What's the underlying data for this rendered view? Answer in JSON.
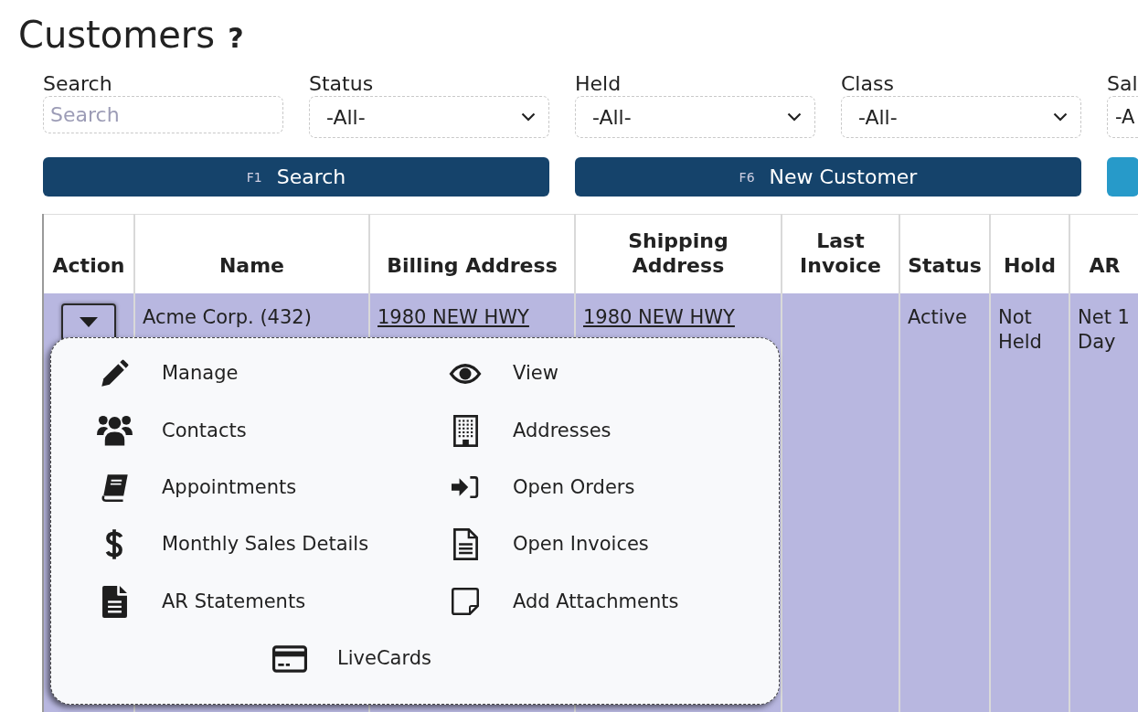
{
  "page": {
    "title": "Customers",
    "help_icon": "?"
  },
  "filters": [
    {
      "label": "Search",
      "kind": "text",
      "placeholder": "Search"
    },
    {
      "label": "Status",
      "kind": "select",
      "value": "-All-"
    },
    {
      "label": "Held",
      "kind": "select",
      "value": "-All-"
    },
    {
      "label": "Class",
      "kind": "select",
      "value": "-All-"
    },
    {
      "label": "Sal",
      "kind": "select",
      "value": "-A"
    }
  ],
  "buttons": [
    {
      "shortcut": "F1",
      "label": "Search",
      "color": "#15436b"
    },
    {
      "shortcut": "F6",
      "label": "New Customer",
      "color": "#15436b"
    },
    {
      "color": "#279ac9"
    }
  ],
  "table": {
    "columns": [
      "Action",
      "Name",
      "Billing Address",
      "Shipping Address",
      "Last Invoice",
      "Status",
      "Hold",
      "AR"
    ],
    "rows": [
      {
        "selected": true,
        "name": "Acme Corp. (432)",
        "billing_address": "1980 NEW HWY",
        "shipping_address": "1980 NEW HWY",
        "status": "Active",
        "hold": "Not Held",
        "ar": "Net 1 Day",
        "action_menu": {
          "expanded": true,
          "items": [
            {
              "label": "Manage"
            },
            {
              "label": "View"
            },
            {
              "label": "Contacts"
            },
            {
              "label": "Addresses"
            },
            {
              "label": "Appointments"
            },
            {
              "label": "Open Orders"
            },
            {
              "label": "Monthly Sales Details"
            },
            {
              "label": "Open Invoices"
            },
            {
              "label": "AR Statements"
            },
            {
              "label": "Add Attachments"
            },
            {
              "label": "LiveCards"
            }
          ]
        }
      }
    ]
  }
}
